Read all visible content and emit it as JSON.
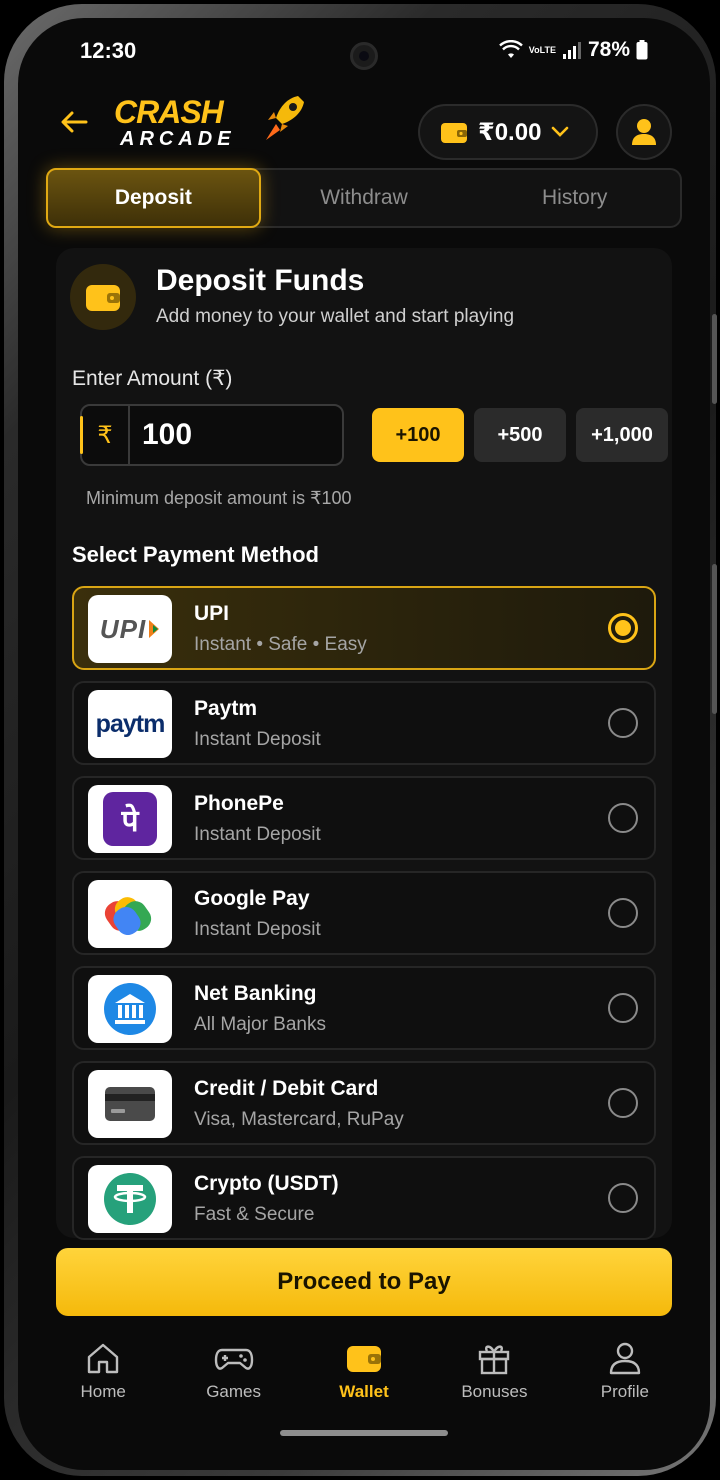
{
  "status_bar": {
    "time": "12:30",
    "network": "VoLTE",
    "battery": "78%"
  },
  "header": {
    "logo_top": "CRASH",
    "logo_bottom": "ARCADE",
    "balance": "₹0.00"
  },
  "tabs": [
    {
      "label": "Deposit",
      "active": true
    },
    {
      "label": "Withdraw",
      "active": false
    },
    {
      "label": "History",
      "active": false
    }
  ],
  "deposit": {
    "title": "Deposit Funds",
    "subtitle": "Add money to your wallet and start playing",
    "amount_label": "Enter Amount (₹)",
    "currency_symbol": "₹",
    "amount_value": "100",
    "quick_amounts": [
      "+100",
      "+500",
      "+1,000"
    ],
    "min_note": "Minimum deposit amount is ₹100"
  },
  "payment": {
    "section_title": "Select Payment Method",
    "methods": [
      {
        "name": "UPI",
        "desc": "Instant • Safe • Easy",
        "icon": "upi-logo",
        "selected": true
      },
      {
        "name": "Paytm",
        "desc": "Instant Deposit",
        "icon": "paytm-logo",
        "selected": false
      },
      {
        "name": "PhonePe",
        "desc": "Instant Deposit",
        "icon": "phonepe-logo",
        "selected": false
      },
      {
        "name": "Google Pay",
        "desc": "Instant Deposit",
        "icon": "google-pay-logo",
        "selected": false
      },
      {
        "name": "Net Banking",
        "desc": "All Major Banks",
        "icon": "bank-icon",
        "selected": false
      },
      {
        "name": "Credit / Debit Card",
        "desc": "Visa, Mastercard, RuPay",
        "icon": "card-icon",
        "selected": false
      },
      {
        "name": "Crypto (USDT)",
        "desc": "Fast & Secure",
        "icon": "tether-icon",
        "selected": false
      }
    ],
    "logo_text": {
      "upi": "UPI",
      "paytm": "paytm",
      "phonepe": "पे"
    }
  },
  "proceed_label": "Proceed to Pay",
  "nav": [
    {
      "label": "Home",
      "icon": "home-icon",
      "active": false
    },
    {
      "label": "Games",
      "icon": "gamepad-icon",
      "active": false
    },
    {
      "label": "Wallet",
      "icon": "wallet-icon",
      "active": true
    },
    {
      "label": "Bonuses",
      "icon": "gift-icon",
      "active": false
    },
    {
      "label": "Profile",
      "icon": "user-icon",
      "active": false
    }
  ],
  "colors": {
    "accent": "#ffc21a",
    "background": "#0a0a0a",
    "card": "#121212"
  }
}
